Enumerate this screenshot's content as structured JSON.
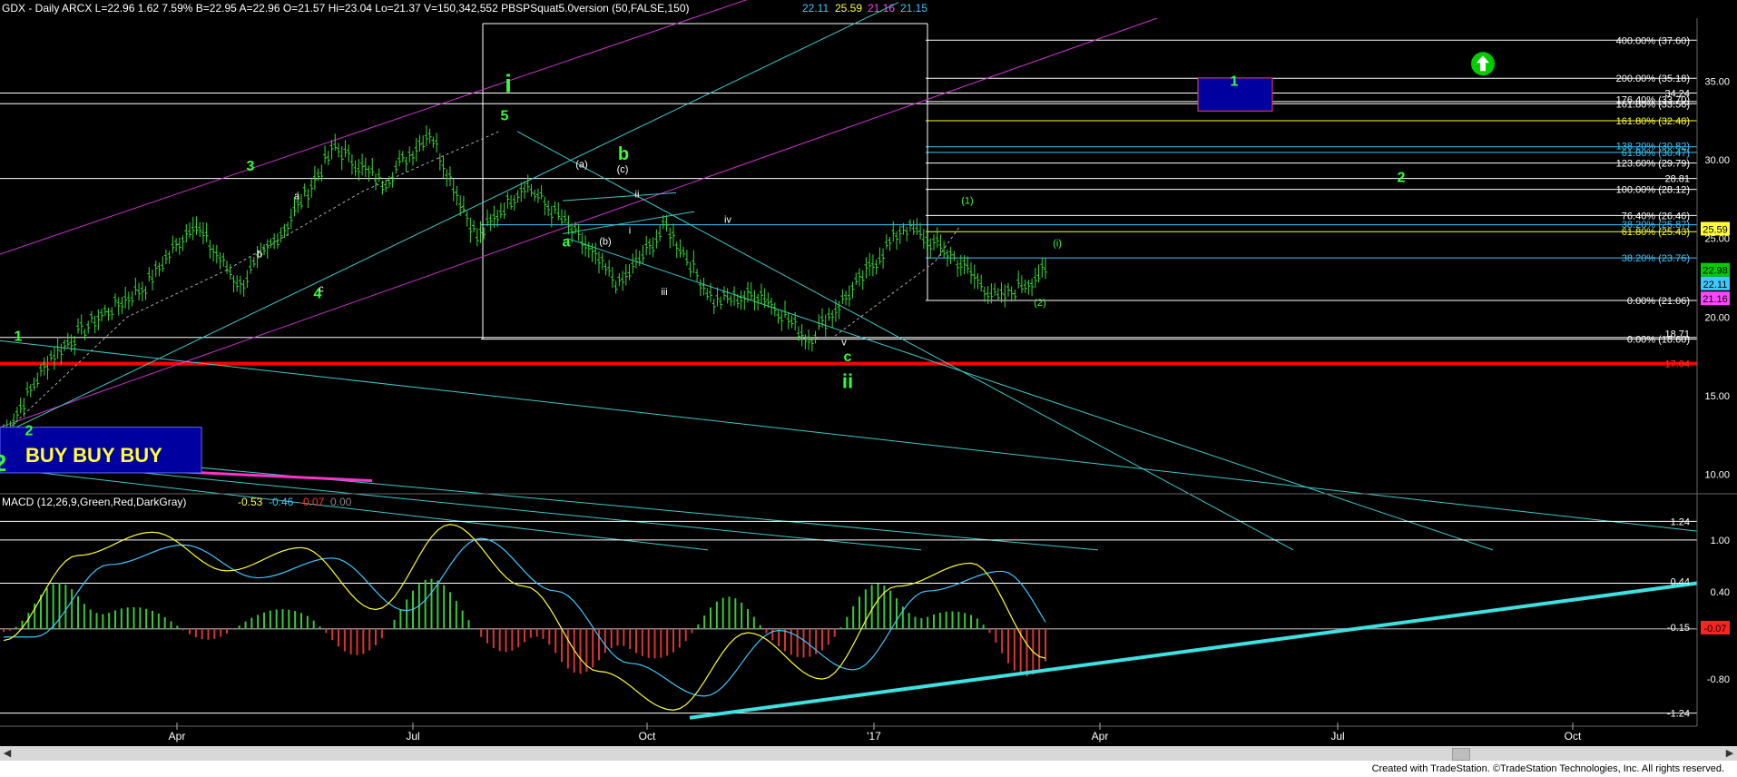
{
  "header": {
    "text": "GDX - Daily  ARCX  L=22.96  1.62  7.59%  B=22.95  A=22.96  O=21.57  Hi=23.04  Lo=21.37  V=150,342,552  PBSPSquat5.0version (50,FALSE,150)",
    "values": [
      {
        "text": "22.11",
        "color": "#3ec8ff"
      },
      {
        "text": "25.59",
        "color": "#ffff33"
      },
      {
        "text": "21.16",
        "color": "#ff44ff"
      },
      {
        "text": "21.15",
        "color": "#3ec8ff"
      }
    ]
  },
  "macd_header": {
    "text": "MACD (12,26,9,Green,Red,DarkGray)",
    "values": [
      {
        "text": "-0.53",
        "color": "#ffff33"
      },
      {
        "text": "-0.46",
        "color": "#3ec8ff"
      },
      {
        "text": "-0.07",
        "color": "#ff3333"
      },
      {
        "text": "0.00",
        "color": "#888888"
      }
    ]
  },
  "chart_data": [
    {
      "type": "candlestick",
      "title": "GDX - Daily",
      "x_ticks": [
        "Apr",
        "Jul",
        "Oct",
        "'17",
        "Apr",
        "Jul",
        "Oct"
      ],
      "price_axis_labels": [
        "35.00",
        "30.00",
        "25.00",
        "20.00",
        "15.00",
        "10.00"
      ],
      "ylim": [
        9,
        39
      ],
      "price_path": [
        {
          "x": "Jan",
          "y": 12.5
        },
        {
          "x": "Feb",
          "y": 17.5
        },
        {
          "x": "Mar",
          "y": 20.0
        },
        {
          "x": "Apr",
          "y": 22.0
        },
        {
          "x": "Apr",
          "y": 26.0
        },
        {
          "x": "May",
          "y": 22.0
        },
        {
          "x": "Jun",
          "y": 26.0
        },
        {
          "x": "Jul",
          "y": 30.8
        },
        {
          "x": "Jul",
          "y": 28.5
        },
        {
          "x": "Aug",
          "y": 31.8
        },
        {
          "x": "Aug",
          "y": 25.0
        },
        {
          "x": "Sep",
          "y": 28.5
        },
        {
          "x": "Sep",
          "y": 25.5
        },
        {
          "x": "Oct",
          "y": 22.0
        },
        {
          "x": "Oct",
          "y": 25.8
        },
        {
          "x": "Nov",
          "y": 21.0
        },
        {
          "x": "Nov",
          "y": 21.5
        },
        {
          "x": "Dec",
          "y": 18.6
        },
        {
          "x": "Jan",
          "y": 22.0
        },
        {
          "x": "Feb",
          "y": 25.8
        },
        {
          "x": "Feb",
          "y": 24.0
        },
        {
          "x": "Mar",
          "y": 21.1
        },
        {
          "x": "Mar",
          "y": 22.96
        }
      ],
      "price_badges": [
        {
          "text": "25.59",
          "color": "#ffff33",
          "fg": "#000000"
        },
        {
          "text": "22.98",
          "color": "#00cc00",
          "fg": "#000000"
        },
        {
          "text": "22.11",
          "color": "#3ec8ff",
          "fg": "#000000"
        },
        {
          "text": "21.16",
          "color": "#ff44ff",
          "fg": "#000000"
        }
      ],
      "fib_labels": [
        {
          "text": "400.00% (37.60)",
          "color": "#ffffff"
        },
        {
          "text": "200.00% (35.18)",
          "color": "#ffffff"
        },
        {
          "text": "34.24",
          "color": "#ffffff"
        },
        {
          "text": "176.40% (33.70)",
          "color": "#ffffff"
        },
        {
          "text": "161.80% (33.56)",
          "color": "#ffffff"
        },
        {
          "text": "161.80% (32.48)",
          "color": "#ffff33"
        },
        {
          "text": "138.20% (30.82)",
          "color": "#3ec8ff"
        },
        {
          "text": "61.80% (30.47)",
          "color": "#3ec8ff"
        },
        {
          "text": "123.60% (29.79)",
          "color": "#ffffff"
        },
        {
          "text": "28.81",
          "color": "#ffffff"
        },
        {
          "text": "100.00% (28.12)",
          "color": "#ffffff"
        },
        {
          "text": "76.40% (26.46)",
          "color": "#ffffff"
        },
        {
          "text": "38.20% (25.87)",
          "color": "#3ec8ff"
        },
        {
          "text": "61.80% (25.43)",
          "color": "#ffff33"
        },
        {
          "text": "38.20% (23.76)",
          "color": "#3ec8ff"
        },
        {
          "text": "0.00% (21.06)",
          "color": "#ffffff"
        },
        {
          "text": "18.71",
          "color": "#ffffff"
        },
        {
          "text": "0.00% (18.60)",
          "color": "#ffffff"
        },
        {
          "text": "17.04",
          "color": "#ff3333"
        }
      ],
      "wave_labels": [
        {
          "text": "1",
          "color": "#33ff33"
        },
        {
          "text": "2",
          "color": "#33ff33"
        },
        {
          "text": "2",
          "color": "#33ff33"
        },
        {
          "text": "3",
          "color": "#33ff33"
        },
        {
          "text": "4",
          "color": "#33ff33"
        },
        {
          "text": "5",
          "color": "#33ff33"
        },
        {
          "text": "i",
          "color": "#33ff33"
        },
        {
          "text": "a",
          "color": "#33ff33"
        },
        {
          "text": "b",
          "color": "#33ff33"
        },
        {
          "text": "c",
          "color": "#33ff33"
        },
        {
          "text": "ii",
          "color": "#33ff33"
        },
        {
          "text": "a",
          "color": "#ffffff"
        },
        {
          "text": "b",
          "color": "#ffffff"
        },
        {
          "text": "c",
          "color": "#ffffff"
        },
        {
          "text": "(a)",
          "color": "#ffffff"
        },
        {
          "text": "(b)",
          "color": "#ffffff"
        },
        {
          "text": "(c)",
          "color": "#ffffff"
        },
        {
          "text": "i",
          "color": "#ffffff"
        },
        {
          "text": "ii",
          "color": "#ffffff"
        },
        {
          "text": "iii",
          "color": "#ffffff"
        },
        {
          "text": "iv",
          "color": "#ffffff"
        },
        {
          "text": "v",
          "color": "#ffffff"
        },
        {
          "text": "(1)",
          "color": "#33ff33"
        },
        {
          "text": "(2)",
          "color": "#33ff33"
        },
        {
          "text": "(i)",
          "color": "#33ff33"
        },
        {
          "text": "1",
          "color": "#33ff33"
        },
        {
          "text": "2",
          "color": "#33ff33"
        }
      ],
      "annotation": "BUY BUY BUY",
      "colors": {
        "channel_magenta": "#cc33cc",
        "trend_cyan": "#3ec8c8",
        "support_red": "#ff0000",
        "buy_box": "#0000a0"
      }
    },
    {
      "type": "macd",
      "title": "MACD (12,26,9,Green,Red,DarkGray)",
      "axis_labels": [
        "1.24",
        "1.00",
        "0.44",
        "0.40",
        "-0.15",
        "-0.07",
        "-0.80",
        "-1.24"
      ],
      "ylim": [
        -1.35,
        1.35
      ],
      "macd_path": [
        {
          "x": "Jan",
          "y": -0.3
        },
        {
          "x": "Feb",
          "y": 0.8
        },
        {
          "x": "Mar",
          "y": 1.1
        },
        {
          "x": "Apr",
          "y": 0.6
        },
        {
          "x": "May",
          "y": 0.9
        },
        {
          "x": "Jun",
          "y": 0.1
        },
        {
          "x": "Jul",
          "y": 1.2
        },
        {
          "x": "Aug",
          "y": 0.4
        },
        {
          "x": "Sep",
          "y": -0.7
        },
        {
          "x": "Oct",
          "y": -1.2
        },
        {
          "x": "Nov",
          "y": -0.2
        },
        {
          "x": "Dec",
          "y": -0.8
        },
        {
          "x": "Jan",
          "y": 0.4
        },
        {
          "x": "Feb",
          "y": 0.7
        },
        {
          "x": "Mar",
          "y": -0.53
        }
      ]
    }
  ],
  "footer": {
    "text": "Created with TradeStation. ©TradeStation Technologies, Inc. All rights reserved."
  },
  "scrollbar": {
    "left_arrow": "◀",
    "right_arrow": "▶"
  }
}
